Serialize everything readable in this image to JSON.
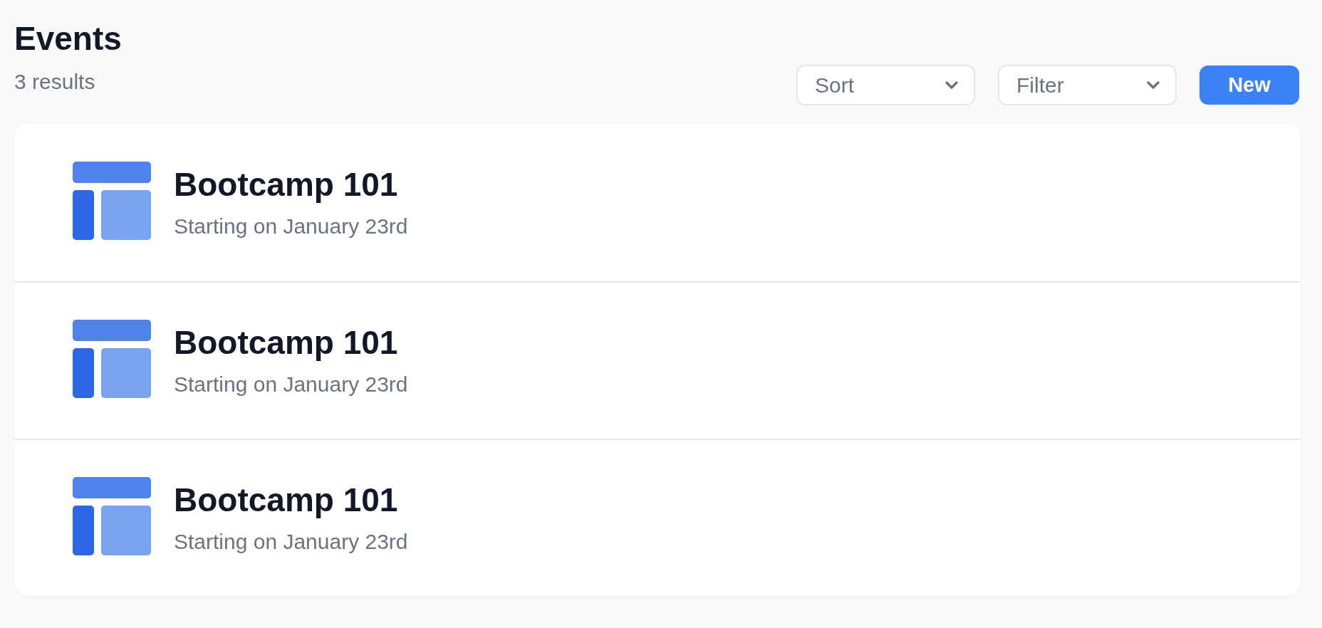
{
  "header": {
    "title": "Events",
    "result_count": "3 results"
  },
  "toolbar": {
    "dropdowns": [
      {
        "label": "Sort"
      },
      {
        "label": "Filter"
      }
    ],
    "new_button": "New"
  },
  "events": [
    {
      "title": "Bootcamp 101",
      "subtitle": "Starting on January 23rd"
    },
    {
      "title": "Bootcamp 101",
      "subtitle": "Starting on January 23rd"
    },
    {
      "title": "Bootcamp 101",
      "subtitle": "Starting on January 23rd"
    }
  ]
}
